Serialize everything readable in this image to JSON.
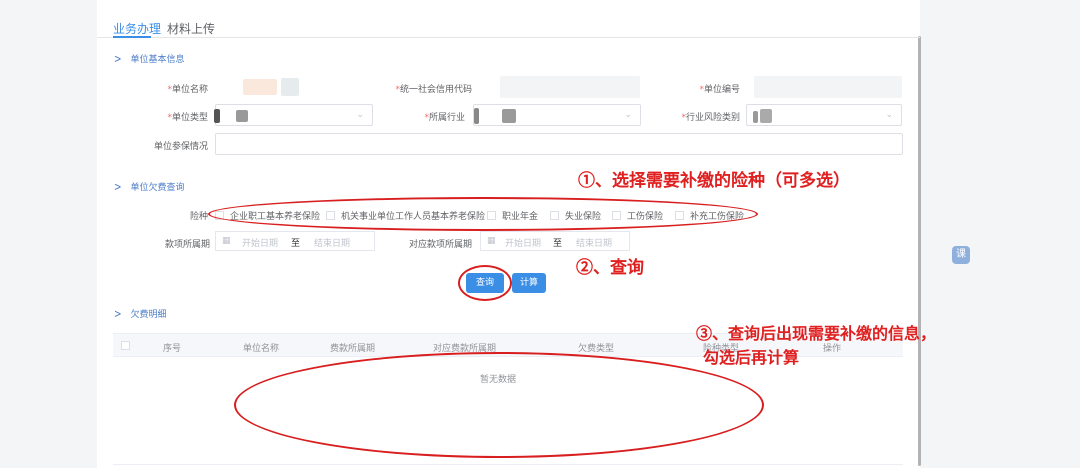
{
  "tabs": [
    {
      "label": "业务办理",
      "active": true
    },
    {
      "label": "材料上传",
      "active": false
    }
  ],
  "section_basic": {
    "title": "单位基本信息",
    "unit_name_label": "单位名称",
    "credit_code_label": "统一社会信用代码",
    "unit_code_label": "单位编号",
    "unit_type_label": "单位类型",
    "industry_label": "所属行业",
    "risk_label": "行业风险类别",
    "insured_label": "单位参保情况"
  },
  "section_arrears": {
    "title": "单位欠费查询",
    "insurance_label": "险种",
    "insurance_options": [
      {
        "label": "企业职工基本养老保险"
      },
      {
        "label": "机关事业单位工作人员基本养老保险"
      },
      {
        "label": "职业年金"
      },
      {
        "label": "失业保险"
      },
      {
        "label": "工伤保险"
      },
      {
        "label": "补充工伤保险"
      }
    ],
    "period_label": "款项所属期",
    "period_start_placeholder": "开始日期",
    "period_sep": "至",
    "period_end_placeholder": "结束日期",
    "corr_period_label": "对应款项所属期",
    "corr_start_placeholder": "开始日期",
    "corr_sep": "至",
    "corr_end_placeholder": "结束日期",
    "query_button": "查询",
    "calc_button": "计算"
  },
  "section_detail": {
    "title": "欠费明细",
    "columns": [
      "序号",
      "单位名称",
      "费款所属期",
      "对应费款所属期",
      "欠费类型",
      "险种类型",
      "操作"
    ],
    "empty_text": "暂无数据"
  },
  "annotations": {
    "step1": "①、选择需要补缴的险种（可多选）",
    "step2": "②、查询",
    "step3_line1": "③、查询后出现需要补缴的信息，",
    "step3_line2": "勾选后再计算"
  },
  "float_button_label": "课",
  "colors": {
    "accent": "#3a8ee6",
    "annotation": "#e02020"
  }
}
